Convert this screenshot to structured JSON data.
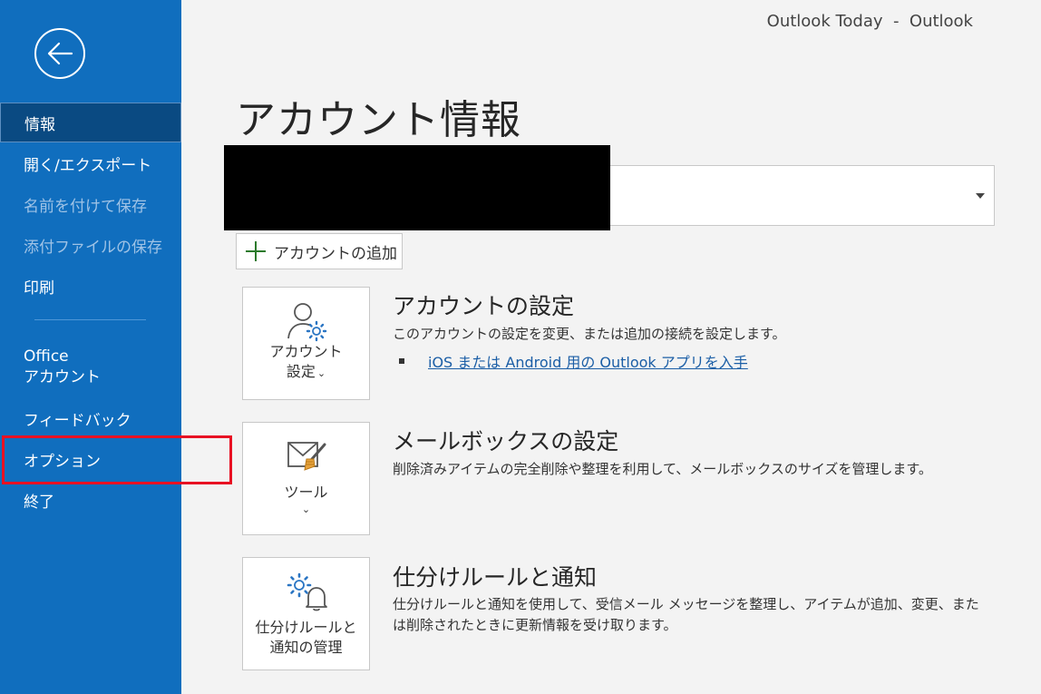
{
  "window": {
    "title": "Outlook Today  -  Outlook"
  },
  "sidebar": {
    "back_icon": "back-arrow-icon",
    "items": [
      {
        "label": "情報",
        "state": "selected"
      },
      {
        "label": "開く/エクスポート",
        "state": "normal"
      },
      {
        "label": "名前を付けて保存",
        "state": "disabled"
      },
      {
        "label": "添付ファイルの保存",
        "state": "disabled"
      },
      {
        "label": "印刷",
        "state": "normal"
      },
      {
        "label_line1": "Office",
        "label_line2": "アカウント",
        "state": "normal"
      },
      {
        "label": "フィードバック",
        "state": "normal"
      },
      {
        "label": "オプション",
        "state": "highlighted"
      },
      {
        "label": "終了",
        "state": "normal"
      }
    ]
  },
  "main": {
    "page_title": "アカウント情報",
    "account_selector": {
      "value": "",
      "redacted": true
    },
    "add_account_label": "アカウントの追加",
    "sections": [
      {
        "tile_line1": "アカウント",
        "tile_line2": "設定",
        "icon": "account-settings-icon",
        "title": "アカウントの設定",
        "description": "このアカウントの設定を変更、または追加の接続を設定します。",
        "link": "iOS または Android 用の Outlook アプリを入手"
      },
      {
        "tile_line1": "ツール",
        "icon": "mailbox-tools-icon",
        "title": "メールボックスの設定",
        "description": "削除済みアイテムの完全削除や整理を利用して、メールボックスのサイズを管理します。"
      },
      {
        "tile_line1": "仕分けルールと",
        "tile_line2": "通知の管理",
        "icon": "rules-alerts-icon",
        "title": "仕分けルールと通知",
        "description_line1": "仕分けルールと通知を使用して、受信メール メッセージを整理し、アイテムが追加、変更、また",
        "description_line2": "は削除されたときに更新情報を受け取ります。"
      }
    ]
  },
  "colors": {
    "sidebar_bg": "#106ebe",
    "sidebar_selected": "#0a4a82",
    "highlight_border": "#e81123",
    "link": "#1b5ea6"
  }
}
